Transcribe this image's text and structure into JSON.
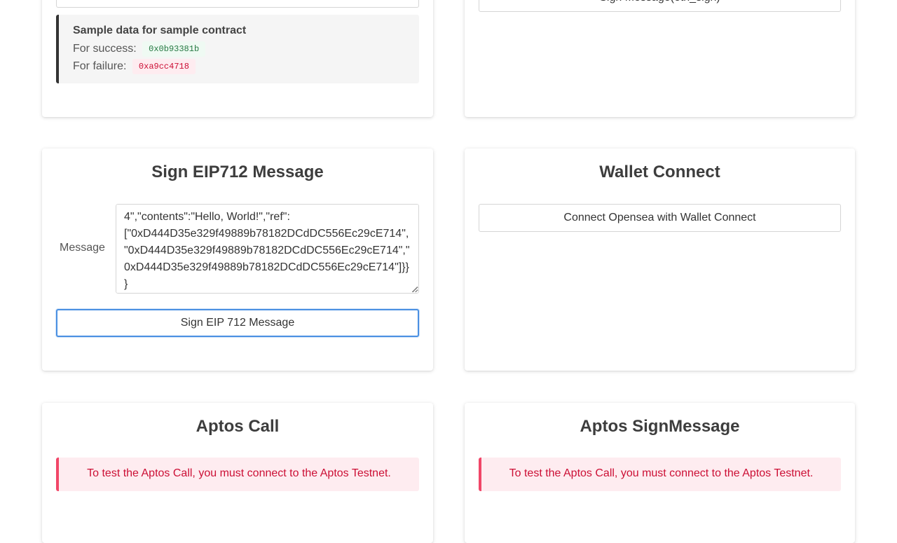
{
  "top_left_card": {
    "sample": {
      "title": "Sample data for sample contract",
      "success_label": "For success:",
      "success_value": "0x0b93381b",
      "failure_label": "For failure:",
      "failure_value": "0xa9cc4718"
    }
  },
  "top_right_card": {
    "button_label": "Sign Message(eth_sign)"
  },
  "eip712_card": {
    "title": "Sign EIP712 Message",
    "message_label": "Message",
    "message_value": "\"from\":{\"name\":\"Alice\",\"wallets\":[\"0xCD2a3d9F938E13CD947Ec05AbC7FE734Df8DD826\",\"0xD444D35e329f49889b78182DCdDC556Ec29cE714\"]},\"to\":[{\"name\":\"Bob\",\"wallets\":[\"0xbBbBBBBbbBBBbbbBbbBbbbbBBbBbbbbBbBbbBBbB\",\"0xB0BdaBea57B0BDABeA57b0bdABEA57b0BDabEa57\",\"0xB0B0b0b0b0b0B000000000000000000000000000\"]}],\"contents\":\"Hello, Bob!\",\"attachment\":\"0x\"}}\n0xD444D35e329f49889b78182DCdDC556Ec29cE714\",\"to\":\"0xD444D35e329f49889b78182DCdDC556Ec29cE714\",\"contents\":\"Hello, World!\",\"ref\":[\"0xD444D35e329f49889b78182DCdDC556Ec29cE714\",\"0xD444D35e329f49889b78182DCdDC556Ec29cE714\",\"0xD444D35e329f49889b78182DCdDC556Ec29cE714\"]}}\n}",
    "sign_button_label": "Sign EIP 712 Message"
  },
  "wallet_connect_card": {
    "title": "Wallet Connect",
    "button_label": "Connect Opensea with Wallet Connect"
  },
  "aptos_call_card": {
    "title": "Aptos Call",
    "notice": "To test the Aptos Call, you must connect to the Aptos Testnet."
  },
  "aptos_sign_card": {
    "title": "Aptos SignMessage",
    "notice": "To test the Aptos Call, you must connect to the Aptos Testnet."
  }
}
